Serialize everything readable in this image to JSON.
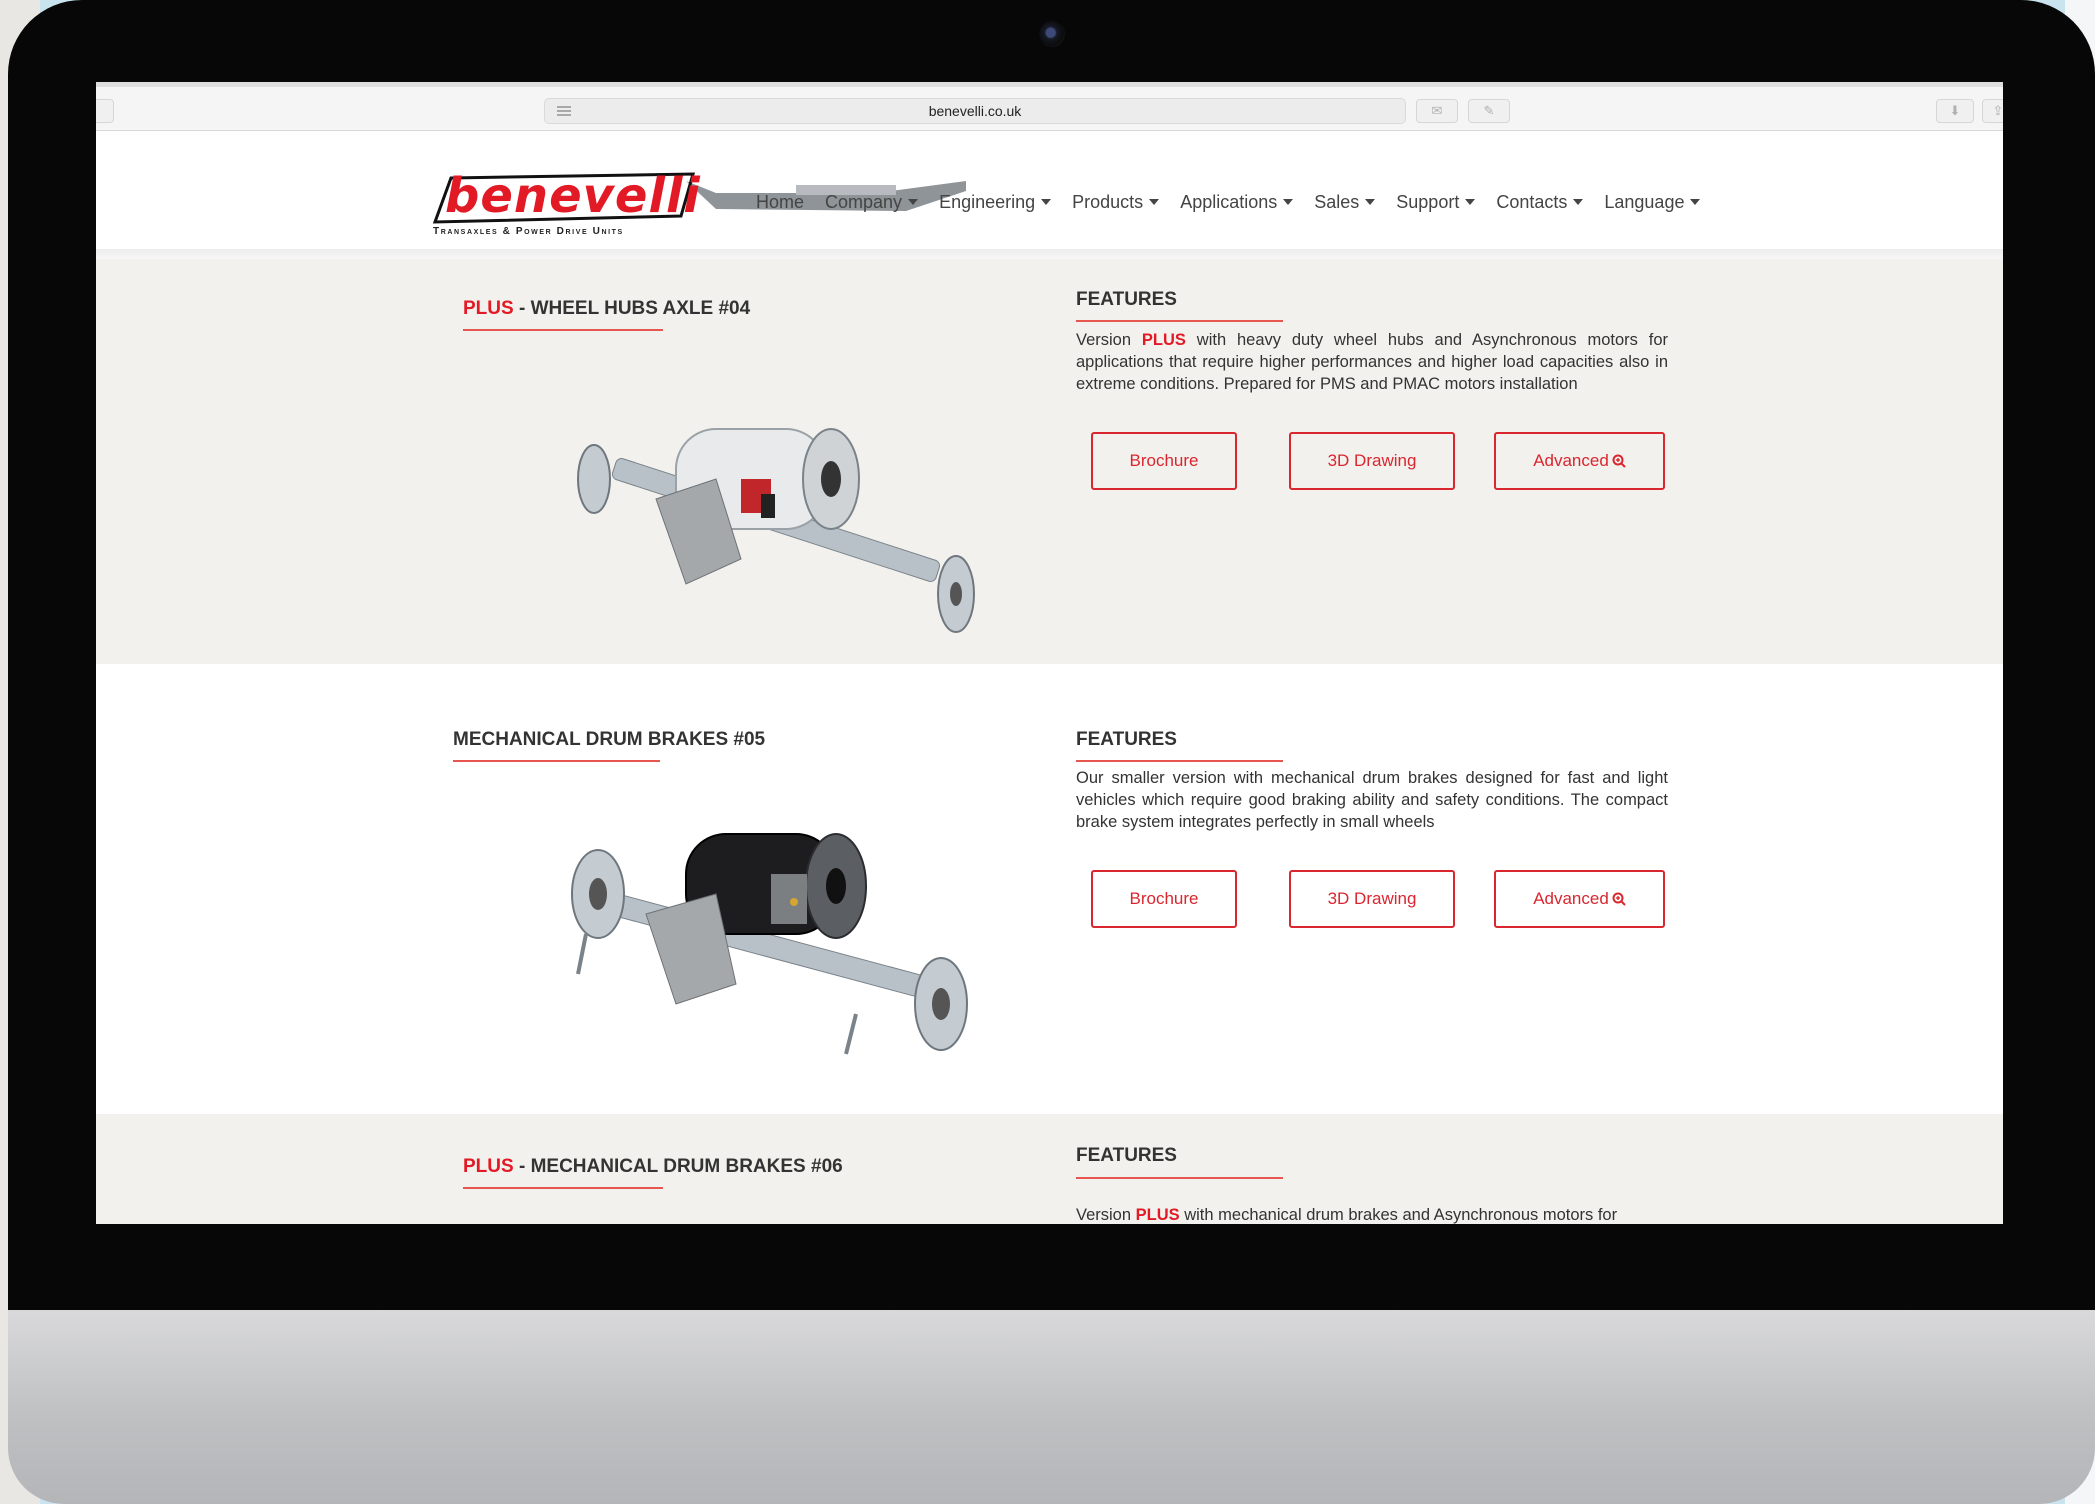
{
  "browser": {
    "url": "benevelli.co.uk"
  },
  "logo": {
    "brand": "benevelli",
    "tagline": "Transaxles & Power Drive Units"
  },
  "nav": {
    "items": [
      {
        "label": "Home",
        "dropdown": false
      },
      {
        "label": "Company",
        "dropdown": true
      },
      {
        "label": "Engineering",
        "dropdown": true
      },
      {
        "label": "Products",
        "dropdown": true
      },
      {
        "label": "Applications",
        "dropdown": true
      },
      {
        "label": "Sales",
        "dropdown": true
      },
      {
        "label": "Support",
        "dropdown": true
      },
      {
        "label": "Contacts",
        "dropdown": true
      },
      {
        "label": "Language",
        "dropdown": true
      }
    ]
  },
  "products": [
    {
      "prefix": "PLUS",
      "title": " - WHEEL HUBS AXLE #04",
      "features_label": "FEATURES",
      "description_prefix": "Version ",
      "description_highlight": "PLUS",
      "description": " with heavy duty wheel hubs and Asynchronous motors for applications that require higher performances and higher load capacities also in extreme conditions. Prepared for PMS and PMAC motors installation",
      "buttons": {
        "brochure": "Brochure",
        "drawing": "3D Drawing",
        "advanced": "Advanced"
      }
    },
    {
      "prefix": "",
      "title": "MECHANICAL DRUM BRAKES #05",
      "features_label": "FEATURES",
      "description_prefix": "",
      "description_highlight": "",
      "description": "Our smaller version with mechanical drum brakes designed for fast and light vehicles which require good braking ability and safety conditions. The compact brake system integrates perfectly in small wheels",
      "buttons": {
        "brochure": "Brochure",
        "drawing": "3D Drawing",
        "advanced": "Advanced"
      }
    },
    {
      "prefix": "PLUS",
      "title": " - MECHANICAL DRUM BRAKES #06",
      "features_label": "FEATURES",
      "description_prefix": "Version ",
      "description_highlight": "PLUS",
      "description": " with mechanical drum brakes and Asynchronous motors for"
    }
  ],
  "icons": {
    "zoom": "zoom-in-icon",
    "caret": "caret-down-icon",
    "reader": "reader-icon"
  },
  "colors": {
    "accent": "#e21a25",
    "section_beige": "#f2f1ed",
    "text": "#333333"
  }
}
